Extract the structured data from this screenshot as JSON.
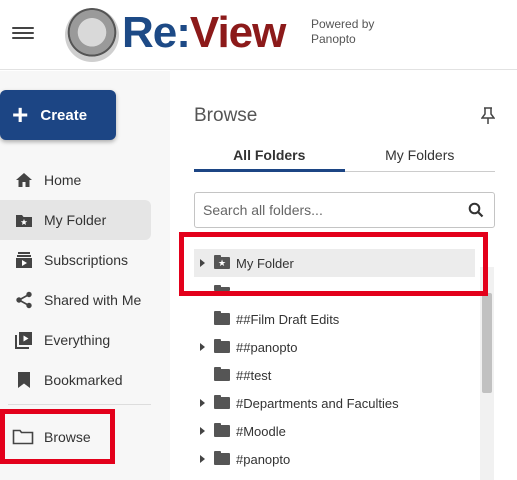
{
  "header": {
    "logo_re": "Re",
    "logo_colon": ":",
    "logo_view": "View",
    "powered_line1": "Powered by",
    "powered_line2": "Panopto"
  },
  "sidebar": {
    "create_label": "Create",
    "items": [
      {
        "label": "Home",
        "icon": "home-icon"
      },
      {
        "label": "My Folder",
        "icon": "star-folder-icon"
      },
      {
        "label": "Subscriptions",
        "icon": "subscriptions-icon"
      },
      {
        "label": "Shared with Me",
        "icon": "share-icon"
      },
      {
        "label": "Everything",
        "icon": "play-library-icon"
      },
      {
        "label": "Bookmarked",
        "icon": "bookmark-icon"
      },
      {
        "label": "Browse",
        "icon": "folder-icon"
      }
    ]
  },
  "browse": {
    "title": "Browse",
    "tabs": [
      "All Folders",
      "My Folders"
    ],
    "active_tab": "All Folders",
    "search_placeholder": "Search all folders...",
    "folders": [
      {
        "label": "My Folder",
        "expandable": true,
        "starred": true
      },
      {
        "label": "",
        "expandable": false,
        "starred": false
      },
      {
        "label": "##Film Draft Edits",
        "expandable": false,
        "starred": false
      },
      {
        "label": "##panopto",
        "expandable": true,
        "starred": false
      },
      {
        "label": "##test",
        "expandable": false,
        "starred": false
      },
      {
        "label": "#Departments and Faculties",
        "expandable": true,
        "starred": false
      },
      {
        "label": "#Moodle",
        "expandable": true,
        "starred": false
      },
      {
        "label": "#panopto",
        "expandable": true,
        "starred": false
      }
    ]
  },
  "colors": {
    "brand_blue": "#1c4584",
    "brand_red": "#8c1a1a",
    "annotation_red": "#e3001b"
  }
}
